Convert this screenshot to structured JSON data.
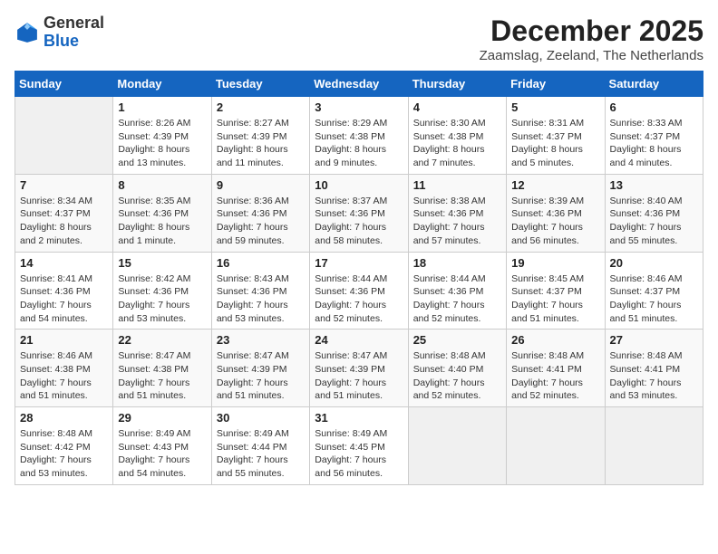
{
  "header": {
    "logo_line1": "General",
    "logo_line2": "Blue",
    "month_title": "December 2025",
    "location": "Zaamslag, Zeeland, The Netherlands"
  },
  "days_of_week": [
    "Sunday",
    "Monday",
    "Tuesday",
    "Wednesday",
    "Thursday",
    "Friday",
    "Saturday"
  ],
  "weeks": [
    [
      {
        "day": "",
        "sunrise": "",
        "sunset": "",
        "daylight": "",
        "empty": true
      },
      {
        "day": "1",
        "sunrise": "Sunrise: 8:26 AM",
        "sunset": "Sunset: 4:39 PM",
        "daylight": "Daylight: 8 hours and 13 minutes."
      },
      {
        "day": "2",
        "sunrise": "Sunrise: 8:27 AM",
        "sunset": "Sunset: 4:39 PM",
        "daylight": "Daylight: 8 hours and 11 minutes."
      },
      {
        "day": "3",
        "sunrise": "Sunrise: 8:29 AM",
        "sunset": "Sunset: 4:38 PM",
        "daylight": "Daylight: 8 hours and 9 minutes."
      },
      {
        "day": "4",
        "sunrise": "Sunrise: 8:30 AM",
        "sunset": "Sunset: 4:38 PM",
        "daylight": "Daylight: 8 hours and 7 minutes."
      },
      {
        "day": "5",
        "sunrise": "Sunrise: 8:31 AM",
        "sunset": "Sunset: 4:37 PM",
        "daylight": "Daylight: 8 hours and 5 minutes."
      },
      {
        "day": "6",
        "sunrise": "Sunrise: 8:33 AM",
        "sunset": "Sunset: 4:37 PM",
        "daylight": "Daylight: 8 hours and 4 minutes."
      }
    ],
    [
      {
        "day": "7",
        "sunrise": "Sunrise: 8:34 AM",
        "sunset": "Sunset: 4:37 PM",
        "daylight": "Daylight: 8 hours and 2 minutes."
      },
      {
        "day": "8",
        "sunrise": "Sunrise: 8:35 AM",
        "sunset": "Sunset: 4:36 PM",
        "daylight": "Daylight: 8 hours and 1 minute."
      },
      {
        "day": "9",
        "sunrise": "Sunrise: 8:36 AM",
        "sunset": "Sunset: 4:36 PM",
        "daylight": "Daylight: 7 hours and 59 minutes."
      },
      {
        "day": "10",
        "sunrise": "Sunrise: 8:37 AM",
        "sunset": "Sunset: 4:36 PM",
        "daylight": "Daylight: 7 hours and 58 minutes."
      },
      {
        "day": "11",
        "sunrise": "Sunrise: 8:38 AM",
        "sunset": "Sunset: 4:36 PM",
        "daylight": "Daylight: 7 hours and 57 minutes."
      },
      {
        "day": "12",
        "sunrise": "Sunrise: 8:39 AM",
        "sunset": "Sunset: 4:36 PM",
        "daylight": "Daylight: 7 hours and 56 minutes."
      },
      {
        "day": "13",
        "sunrise": "Sunrise: 8:40 AM",
        "sunset": "Sunset: 4:36 PM",
        "daylight": "Daylight: 7 hours and 55 minutes."
      }
    ],
    [
      {
        "day": "14",
        "sunrise": "Sunrise: 8:41 AM",
        "sunset": "Sunset: 4:36 PM",
        "daylight": "Daylight: 7 hours and 54 minutes."
      },
      {
        "day": "15",
        "sunrise": "Sunrise: 8:42 AM",
        "sunset": "Sunset: 4:36 PM",
        "daylight": "Daylight: 7 hours and 53 minutes."
      },
      {
        "day": "16",
        "sunrise": "Sunrise: 8:43 AM",
        "sunset": "Sunset: 4:36 PM",
        "daylight": "Daylight: 7 hours and 53 minutes."
      },
      {
        "day": "17",
        "sunrise": "Sunrise: 8:44 AM",
        "sunset": "Sunset: 4:36 PM",
        "daylight": "Daylight: 7 hours and 52 minutes."
      },
      {
        "day": "18",
        "sunrise": "Sunrise: 8:44 AM",
        "sunset": "Sunset: 4:36 PM",
        "daylight": "Daylight: 7 hours and 52 minutes."
      },
      {
        "day": "19",
        "sunrise": "Sunrise: 8:45 AM",
        "sunset": "Sunset: 4:37 PM",
        "daylight": "Daylight: 7 hours and 51 minutes."
      },
      {
        "day": "20",
        "sunrise": "Sunrise: 8:46 AM",
        "sunset": "Sunset: 4:37 PM",
        "daylight": "Daylight: 7 hours and 51 minutes."
      }
    ],
    [
      {
        "day": "21",
        "sunrise": "Sunrise: 8:46 AM",
        "sunset": "Sunset: 4:38 PM",
        "daylight": "Daylight: 7 hours and 51 minutes."
      },
      {
        "day": "22",
        "sunrise": "Sunrise: 8:47 AM",
        "sunset": "Sunset: 4:38 PM",
        "daylight": "Daylight: 7 hours and 51 minutes."
      },
      {
        "day": "23",
        "sunrise": "Sunrise: 8:47 AM",
        "sunset": "Sunset: 4:39 PM",
        "daylight": "Daylight: 7 hours and 51 minutes."
      },
      {
        "day": "24",
        "sunrise": "Sunrise: 8:47 AM",
        "sunset": "Sunset: 4:39 PM",
        "daylight": "Daylight: 7 hours and 51 minutes."
      },
      {
        "day": "25",
        "sunrise": "Sunrise: 8:48 AM",
        "sunset": "Sunset: 4:40 PM",
        "daylight": "Daylight: 7 hours and 52 minutes."
      },
      {
        "day": "26",
        "sunrise": "Sunrise: 8:48 AM",
        "sunset": "Sunset: 4:41 PM",
        "daylight": "Daylight: 7 hours and 52 minutes."
      },
      {
        "day": "27",
        "sunrise": "Sunrise: 8:48 AM",
        "sunset": "Sunset: 4:41 PM",
        "daylight": "Daylight: 7 hours and 53 minutes."
      }
    ],
    [
      {
        "day": "28",
        "sunrise": "Sunrise: 8:48 AM",
        "sunset": "Sunset: 4:42 PM",
        "daylight": "Daylight: 7 hours and 53 minutes."
      },
      {
        "day": "29",
        "sunrise": "Sunrise: 8:49 AM",
        "sunset": "Sunset: 4:43 PM",
        "daylight": "Daylight: 7 hours and 54 minutes."
      },
      {
        "day": "30",
        "sunrise": "Sunrise: 8:49 AM",
        "sunset": "Sunset: 4:44 PM",
        "daylight": "Daylight: 7 hours and 55 minutes."
      },
      {
        "day": "31",
        "sunrise": "Sunrise: 8:49 AM",
        "sunset": "Sunset: 4:45 PM",
        "daylight": "Daylight: 7 hours and 56 minutes."
      },
      {
        "day": "",
        "sunrise": "",
        "sunset": "",
        "daylight": "",
        "empty": true
      },
      {
        "day": "",
        "sunrise": "",
        "sunset": "",
        "daylight": "",
        "empty": true
      },
      {
        "day": "",
        "sunrise": "",
        "sunset": "",
        "daylight": "",
        "empty": true
      }
    ]
  ]
}
